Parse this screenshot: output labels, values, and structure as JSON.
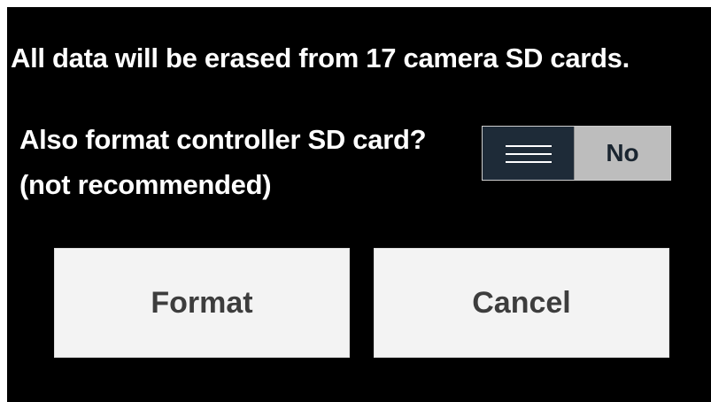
{
  "dialog": {
    "message": "All data will be erased from 17 camera SD cards.",
    "question": "Also format controller SD card?  (not recommended)",
    "toggle": {
      "icon": "hamburger-lines-icon",
      "value_label": "No"
    },
    "buttons": {
      "format_label": "Format",
      "cancel_label": "Cancel"
    }
  },
  "colors": {
    "background": "#000000",
    "text": "#ffffff",
    "toggle_knob": "#1e2b38",
    "toggle_track": "#bdbdbd",
    "button_bg": "#f3f3f3",
    "button_text": "#3d3d3d"
  }
}
